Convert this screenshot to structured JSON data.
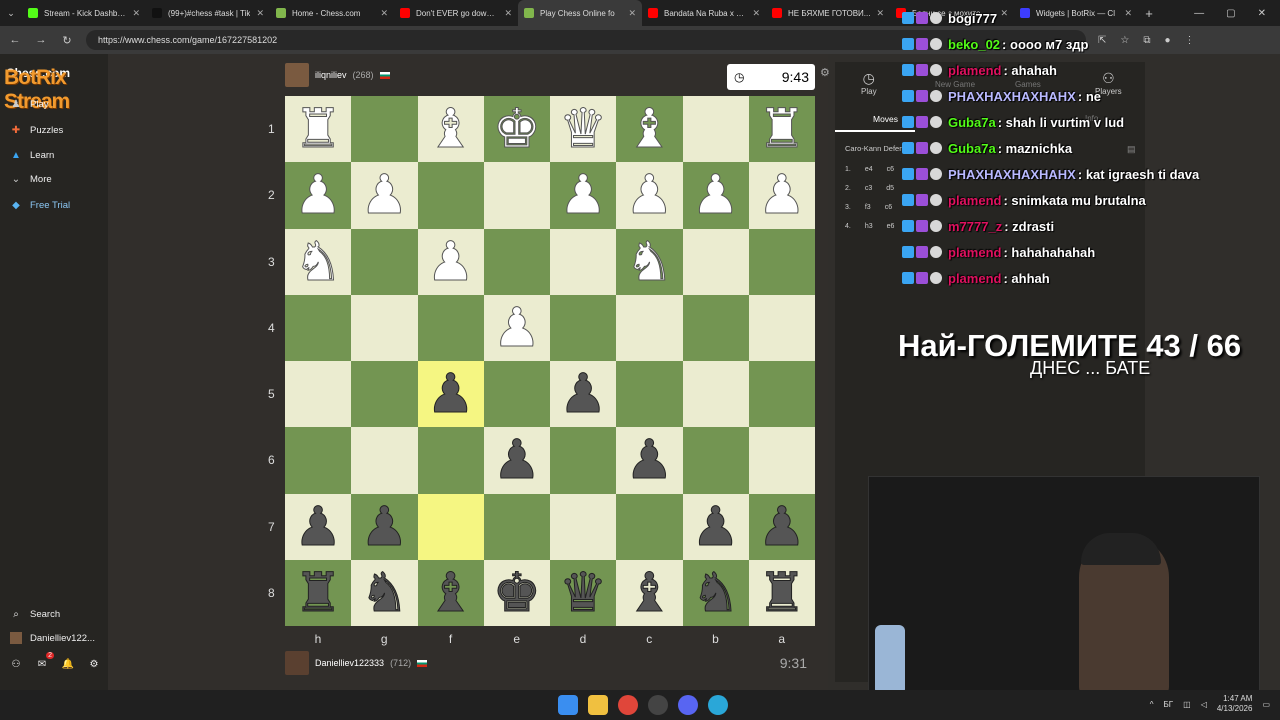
{
  "browser": {
    "tabs": [
      {
        "label": "Stream - Kick Dashboar",
        "color": "#53fc18",
        "active": false
      },
      {
        "label": "(99+)#chess #task | Tik",
        "color": "#111111",
        "active": false
      },
      {
        "label": "Home - Chess.com",
        "color": "#81b64c",
        "active": false
      },
      {
        "label": "Don't EVER go down he",
        "color": "#ff0000",
        "active": false
      },
      {
        "label": "Play Chess Online fo",
        "color": "#81b64c",
        "active": true
      },
      {
        "label": "Bandata Na Ruba x Dim",
        "color": "#ff0000",
        "active": false
      },
      {
        "label": "НЕ БЯХМЕ ГОТОВИ...",
        "color": "#ff0000",
        "active": false
      },
      {
        "label": "Бояни се с мохито",
        "color": "#ff0000",
        "active": false
      },
      {
        "label": "Widgets | BotRix — Cl",
        "color": "#3d3dff",
        "active": false
      }
    ],
    "url": "https://www.chess.com/game/167227581202"
  },
  "sidebar": {
    "logo": "Chess.com",
    "overlay": "BotRix Stream",
    "items": [
      {
        "label": "Play",
        "icon": "pawn-icon",
        "color": "#cccccc"
      },
      {
        "label": "Puzzles",
        "icon": "puzzle-icon",
        "color": "#f26b3a"
      },
      {
        "label": "Learn",
        "icon": "graduation-icon",
        "color": "#3aa5f2"
      },
      {
        "label": "More",
        "icon": "chevron-down-icon",
        "color": "#cccccc"
      },
      {
        "label": "Free Trial",
        "icon": "diamond-icon",
        "color": "#5ab4f2"
      }
    ],
    "bottom": {
      "search": "Search",
      "username": "Danielliev122...",
      "notif_count": "2"
    }
  },
  "game": {
    "top_player": {
      "name": "iliqniliev",
      "rating": "(268)",
      "clock": "9:43"
    },
    "bottom_player": {
      "name": "Danielliev122333",
      "rating": "(712)",
      "clock": "9:31"
    },
    "ranks": [
      "1",
      "2",
      "3",
      "4",
      "5",
      "6",
      "7",
      "8"
    ],
    "files": [
      "h",
      "g",
      "f",
      "e",
      "d",
      "c",
      "b",
      "a"
    ],
    "board": [
      [
        "wR",
        "",
        "wB",
        "wK",
        "wQ",
        "wB",
        "",
        "wR"
      ],
      [
        "wP",
        "wP",
        "",
        "",
        "wP",
        "wP",
        "wP",
        "wP"
      ],
      [
        "wN",
        "",
        "wP",
        "",
        "",
        "wN",
        "",
        ""
      ],
      [
        "",
        "",
        "",
        "wP",
        "",
        "",
        "",
        ""
      ],
      [
        "",
        "",
        "bP",
        "",
        "bP",
        "",
        "",
        ""
      ],
      [
        "",
        "",
        "",
        "bP",
        "",
        "bP",
        "",
        ""
      ],
      [
        "bP",
        "bP",
        "",
        "",
        "",
        "",
        "bP",
        "bP"
      ],
      [
        "bR",
        "bN",
        "bB",
        "bK",
        "bQ",
        "bB",
        "bN",
        "bR"
      ]
    ],
    "highlighted": [
      [
        4,
        2
      ],
      [
        6,
        2
      ]
    ]
  },
  "right_panel": {
    "tabs": [
      "Play",
      "New Game",
      "Games",
      "Players"
    ],
    "moves_tab": "Moves",
    "info_tab": "Info",
    "opening": "Caro-Kann Defen",
    "moves": [
      {
        "n": "1.",
        "w": "e4",
        "b": "c6"
      },
      {
        "n": "2.",
        "w": "c3",
        "b": "d5"
      },
      {
        "n": "3.",
        "w": "f3",
        "b": "c6"
      },
      {
        "n": "4.",
        "w": "h3",
        "b": "e6"
      }
    ]
  },
  "chat": [
    {
      "user": "bogi777",
      "msg": "",
      "color": "#ffffff"
    },
    {
      "user": "beko_02",
      "msg": "оооо м7 здр",
      "color": "#53fc18"
    },
    {
      "user": "plamend",
      "msg": "ahahah",
      "color": "#e0115f"
    },
    {
      "user": "PHAXHAXHAXHAHX",
      "msg": "ne",
      "color": "#b9b9ff"
    },
    {
      "user": "Guba7a",
      "msg": "shah li vurtim v lud",
      "color": "#53fc18"
    },
    {
      "user": "Guba7a",
      "msg": "maznichka",
      "color": "#53fc18"
    },
    {
      "user": "PHAXHAXHAXHAHX",
      "msg": "kat igraesh ti dava",
      "color": "#b9b9ff"
    },
    {
      "user": "plamend",
      "msg": "snimkata mu brutalna",
      "color": "#e0115f"
    },
    {
      "user": "m7777_z",
      "msg": "zdrasti",
      "color": "#e0115f"
    },
    {
      "user": "plamend",
      "msg": "hahahahahah",
      "color": "#e0115f"
    },
    {
      "user": "plamend",
      "msg": "ahhah",
      "color": "#e0115f"
    }
  ],
  "goal": {
    "title": "Най-ГОЛЕМИТЕ 43 / 66",
    "subtitle": "ДНЕС ... БАТЕ"
  },
  "taskbar": {
    "time": "1:47 AM",
    "date": "4/13/2026",
    "lang": "БГ"
  }
}
